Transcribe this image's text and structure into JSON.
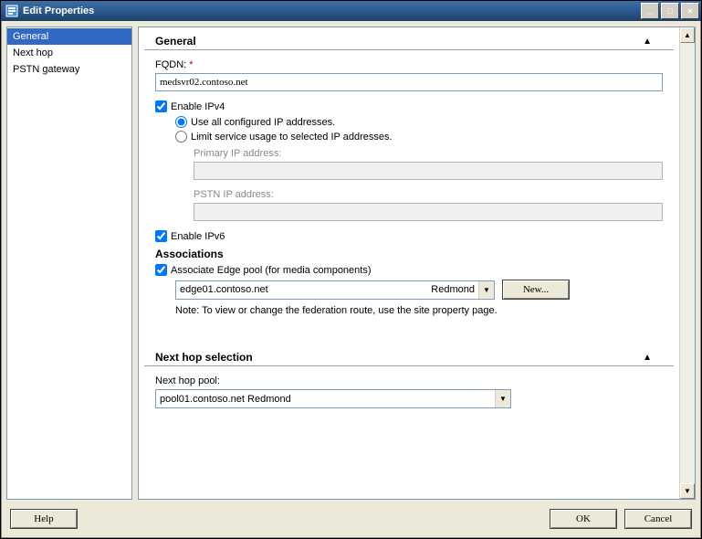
{
  "window": {
    "title": "Edit Properties"
  },
  "winbtns": {
    "min": "_",
    "max": "□",
    "close": "×"
  },
  "nav": {
    "items": [
      {
        "label": "General",
        "selected": true
      },
      {
        "label": "Next hop"
      },
      {
        "label": "PSTN gateway"
      }
    ]
  },
  "sections": {
    "general": {
      "title": "General"
    },
    "nexthop": {
      "title": "Next hop selection"
    }
  },
  "general": {
    "fqdn_label": "FQDN:",
    "fqdn_value": "medsvr02.contoso.net",
    "enable_ipv4_label": "Enable IPv4",
    "enable_ipv4_checked": true,
    "radio_all_label": "Use all configured IP addresses.",
    "radio_limit_label": "Limit service usage to selected IP addresses.",
    "primary_ip_label": "Primary IP address:",
    "primary_ip_value": "",
    "pstn_ip_label": "PSTN IP address:",
    "pstn_ip_value": "",
    "enable_ipv6_label": "Enable IPv6",
    "enable_ipv6_checked": true
  },
  "associations": {
    "header": "Associations",
    "edge_check_label": "Associate Edge pool (for media components)",
    "edge_check_checked": true,
    "edge_value_host": "edge01.contoso.net",
    "edge_value_site": "Redmond",
    "new_btn": "New...",
    "note": "Note: To view or change the federation route, use the site property page."
  },
  "nexthop": {
    "pool_label": "Next hop pool:",
    "pool_value": "pool01.contoso.net   Redmond"
  },
  "footer": {
    "help": "Help",
    "ok": "OK",
    "cancel": "Cancel"
  }
}
